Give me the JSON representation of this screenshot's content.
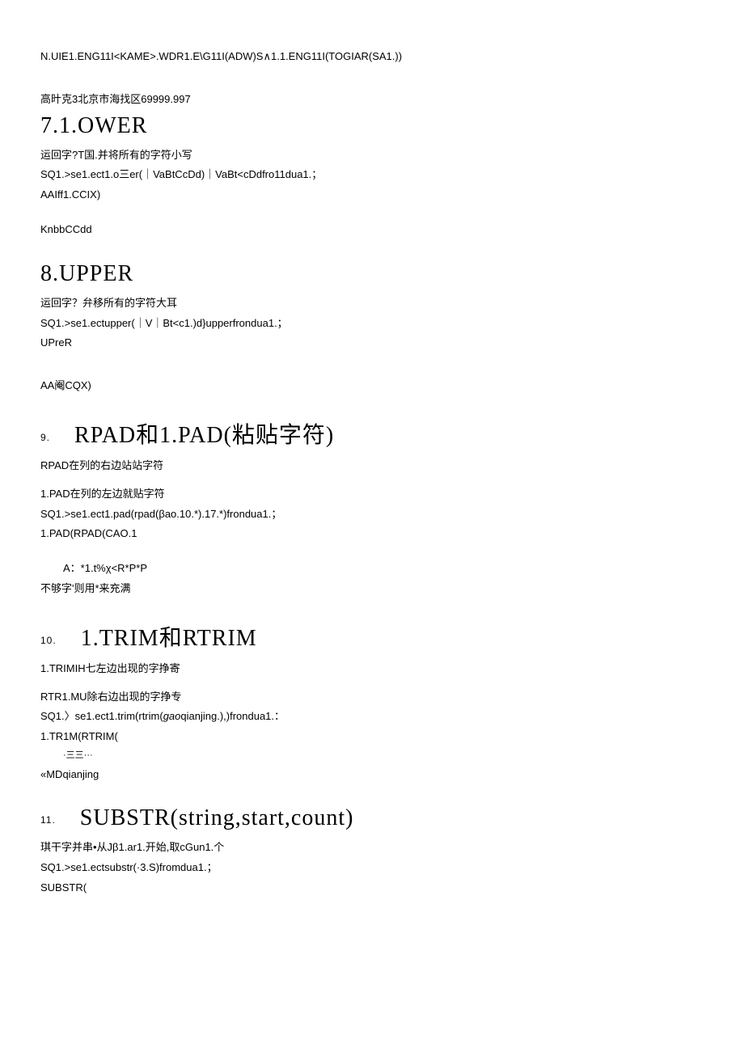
{
  "topLine": "N.UIE1.ENG11I<KAME>.WDR1.E\\G11I(ADW)S∧1.1.ENG11I(TOGIAR(SA1.))",
  "resultLine": "高旪克3北京市海找区69999.997",
  "s7": {
    "heading": "7.1.OWER",
    "desc": "运回字?T国.并将所有的字符小写",
    "code1": "SQ1.>se1.ect1.o三er(｜VaBtCcDd)｜VaBt<cDdfro11dua1.；",
    "code2": "AAIff1.CCIX)",
    "result": "KnbbCCdd"
  },
  "s8": {
    "heading": "8.UPPER",
    "desc": "运回字？弁移所有的字符大耳",
    "code1": "SQ1.>se1.ectupper(｜V｜Bt<c1.)d}upperfrondua1.；",
    "code2": "UPreR",
    "result": "AA阉CQX)"
  },
  "s9": {
    "num": "9.",
    "heading": "RPAD和1.PAD(粘贴字符)",
    "desc1": "RPAD在列的右边站站字符",
    "desc2": "1.PAD在列的左边就贴字符",
    "code1": "SQ1.>se1.ect1.pad(rpad(βao.10.*).17.*)frondua1.；",
    "code2": "1.PAD(RPAD(CAO.1",
    "result1": "A：*1.t%χ<R*P*P",
    "result2": "不够字'则用*来充满"
  },
  "s10": {
    "num": "10.",
    "heading": "1.TRIM和RTRIM",
    "desc1": "1.TRIMIH七左边出现的字挣寄",
    "desc2": "RTR1.MU除右边出现的字挣专",
    "code1": "SQ1.〉se1.ect1.trim(rtrim(gaoqianjing.),)frondua1.：",
    "code2": "1.TR1M(RTRIM(",
    "dots": "·三三···",
    "result": "«MDqianjing"
  },
  "s11": {
    "num": "11.",
    "heading": "SUBSTR(string,start,count)",
    "desc": "琪干字并串•从Jβ1.ar1.开始,取cGun1.个",
    "code1": "SQ1.>se1.ectsubstr(·3.S)fromdua1.；",
    "code2": "SUBSTR("
  }
}
